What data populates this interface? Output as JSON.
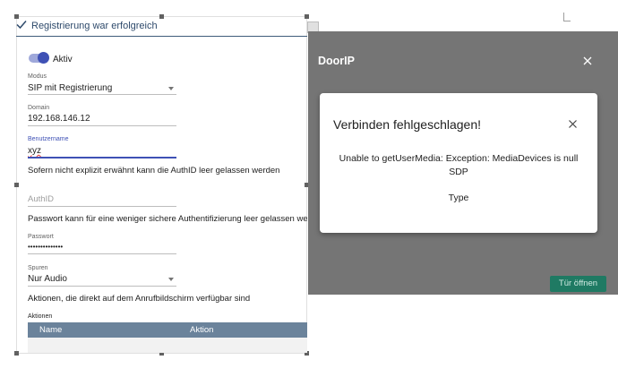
{
  "editor": {
    "success_message": "Registrierung war erfolgreich",
    "active_toggle": {
      "label": "Aktiv",
      "checked": true
    },
    "mode": {
      "label": "Modus",
      "value": "SIP mit Registrierung"
    },
    "domain": {
      "label": "Domain",
      "value": "192.168.146.12"
    },
    "username": {
      "label": "Benutzername",
      "value": "xyz"
    },
    "authid_hint": "Sofern nicht explizit erwähnt kann die AuthID leer gelassen werden",
    "authid": {
      "placeholder": "AuthID"
    },
    "password_hint": "Passwort kann für eine weniger sichere Authentifizierung leer gelassen werden",
    "password": {
      "label": "Passwort",
      "value": "••••••••••••••"
    },
    "tracks": {
      "label": "Spuren",
      "value": "Nur Audio"
    },
    "actions_hint": "Aktionen, die direkt auf dem Anrufbildschirm verfügbar sind",
    "actions_table": {
      "label": "Aktionen",
      "columns": [
        "Name",
        "Aktion"
      ]
    }
  },
  "preview": {
    "title": "DoorIP",
    "open_door_button": "Tür öffnen"
  },
  "dialog": {
    "title": "Verbinden fehlgeschlagen!",
    "message_line1": "Unable to getUserMedia: Exception: MediaDevices is null",
    "message_line2": "SDP",
    "message_line3": "Type"
  },
  "colors": {
    "accent": "#3f51b5",
    "table_header": "#6b839b",
    "door_button": "#1f7a63",
    "preview_background": "#757575"
  },
  "icons": {
    "success": "check-icon",
    "preview_close": "close-icon",
    "dialog_close": "close-icon",
    "dropdown": "chevron-down-icon"
  }
}
